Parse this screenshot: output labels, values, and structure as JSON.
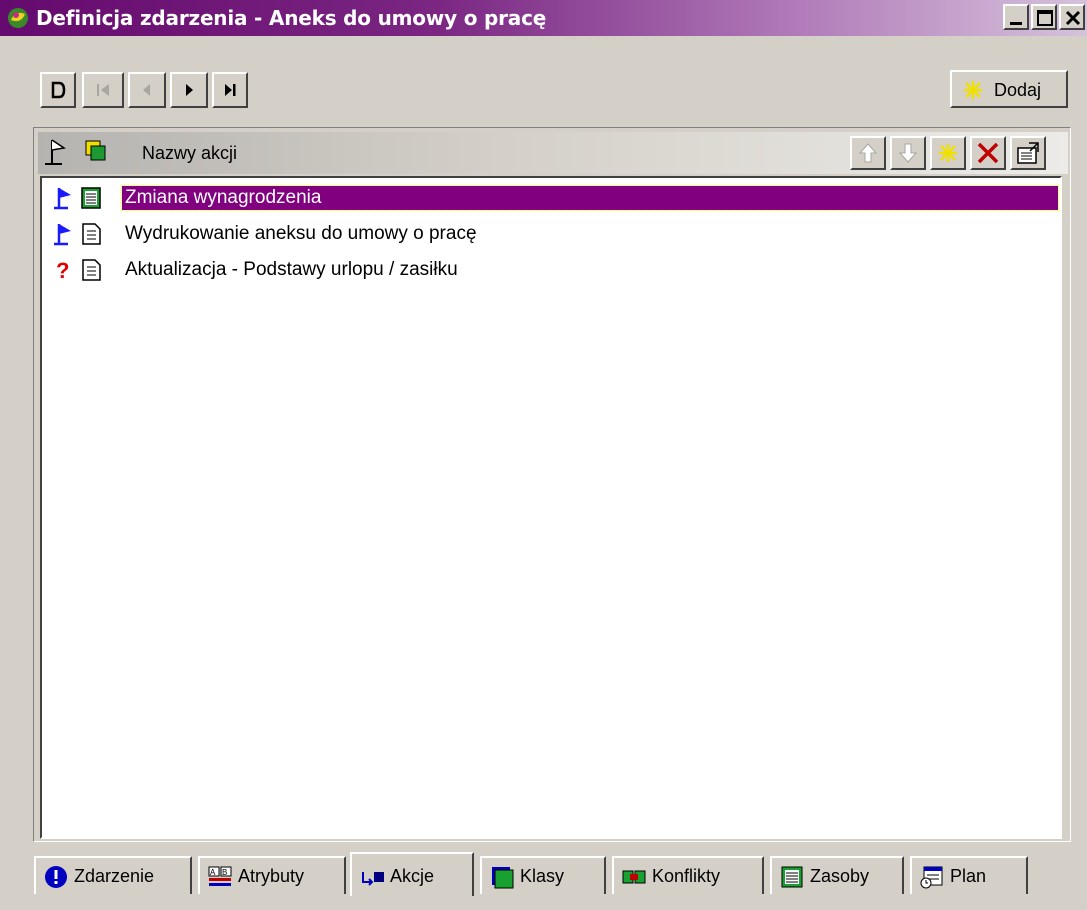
{
  "window": {
    "title": "Definicja zdarzenia - Aneks do umowy o pracę"
  },
  "toolbar": {
    "add_label": "Dodaj"
  },
  "list": {
    "column_header": "Nazwy akcji",
    "items": [
      {
        "label": "Zmiana wynagrodzenia",
        "status": "flag",
        "selected": true
      },
      {
        "label": "Wydrukowanie aneksu do umowy o pracę",
        "status": "flag",
        "selected": false
      },
      {
        "label": "Aktualizacja - Podstawy urlopu / zasiłku",
        "status": "question",
        "selected": false
      }
    ]
  },
  "tabs": [
    {
      "label": "Zdarzenie",
      "icon": "info-icon"
    },
    {
      "label": "Atrybuty",
      "icon": "attributes-icon"
    },
    {
      "label": "Akcje",
      "icon": "actions-icon",
      "active": true
    },
    {
      "label": "Klasy",
      "icon": "classes-icon"
    },
    {
      "label": "Konflikty",
      "icon": "conflicts-icon"
    },
    {
      "label": "Zasoby",
      "icon": "resources-icon"
    },
    {
      "label": "Plan",
      "icon": "plan-icon"
    }
  ],
  "colors": {
    "title_bar": "#650a6e",
    "selection": "#800080",
    "face": "#d4d0c8"
  }
}
